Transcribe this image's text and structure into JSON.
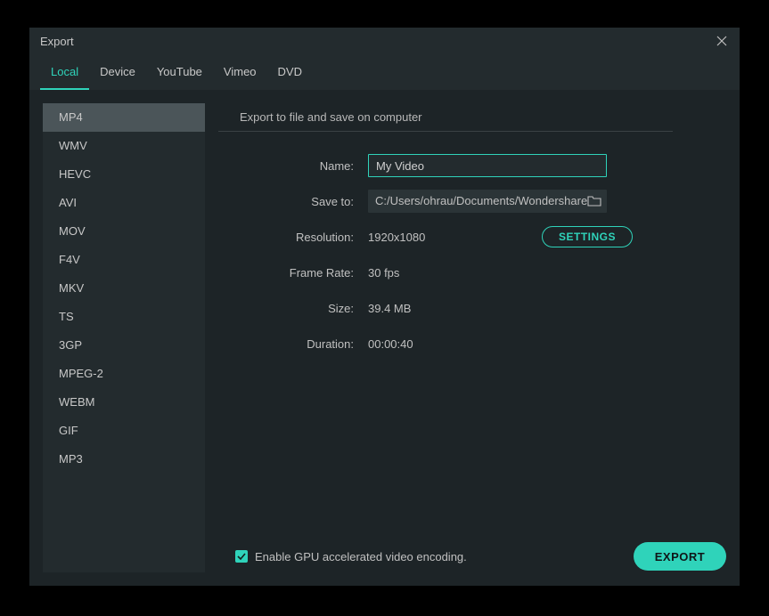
{
  "window": {
    "title": "Export"
  },
  "tabs": [
    {
      "label": "Local",
      "active": true
    },
    {
      "label": "Device",
      "active": false
    },
    {
      "label": "YouTube",
      "active": false
    },
    {
      "label": "Vimeo",
      "active": false
    },
    {
      "label": "DVD",
      "active": false
    }
  ],
  "formats": [
    {
      "label": "MP4",
      "selected": true
    },
    {
      "label": "WMV"
    },
    {
      "label": "HEVC"
    },
    {
      "label": "AVI"
    },
    {
      "label": "MOV"
    },
    {
      "label": "F4V"
    },
    {
      "label": "MKV"
    },
    {
      "label": "TS"
    },
    {
      "label": "3GP"
    },
    {
      "label": "MPEG-2"
    },
    {
      "label": "WEBM"
    },
    {
      "label": "GIF"
    },
    {
      "label": "MP3"
    }
  ],
  "main": {
    "section_title": "Export to file and save on computer",
    "name_label": "Name:",
    "name_value": "My Video",
    "saveto_label": "Save to:",
    "saveto_value": "C:/Users/ohrau/Documents/Wondershare",
    "resolution_label": "Resolution:",
    "resolution_value": "1920x1080",
    "settings_label": "SETTINGS",
    "framerate_label": "Frame Rate:",
    "framerate_value": "30 fps",
    "size_label": "Size:",
    "size_value": "39.4 MB",
    "duration_label": "Duration:",
    "duration_value": "00:00:40"
  },
  "footer": {
    "gpu_checkbox_label": "Enable GPU accelerated video encoding.",
    "gpu_checked": true,
    "export_label": "EXPORT"
  },
  "colors": {
    "accent": "#2fd3ba"
  }
}
